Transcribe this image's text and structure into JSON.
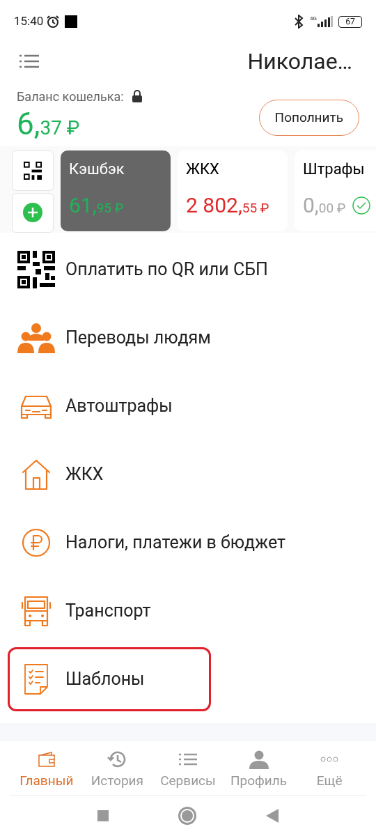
{
  "status_bar": {
    "time": "15:40",
    "network": "4G",
    "battery": "67"
  },
  "header": {
    "user_name": "Николае…"
  },
  "wallet": {
    "label": "Баланс кошелька:",
    "amount_whole": "6,",
    "amount_cents": "37 ₽",
    "top_up_button": "Пополнить"
  },
  "cards": [
    {
      "title": "Кэшбэк",
      "amount_whole": "61,",
      "amount_cents": "95 ₽",
      "selected": true,
      "color": "#1fb35a",
      "paid": false
    },
    {
      "title": "ЖКХ",
      "amount_whole": "2 802,",
      "amount_cents": "55 ₽",
      "selected": false,
      "color": "#e02a2a",
      "paid": false
    },
    {
      "title": "Штрафы",
      "amount_whole": "0,",
      "amount_cents": "00 ₽",
      "selected": false,
      "color": "#a8a8a8",
      "paid": true
    }
  ],
  "menu": [
    {
      "kind": "qr",
      "label": "Оплатить по QR или СБП",
      "highlighted": false
    },
    {
      "kind": "people",
      "label": "Переводы людям",
      "highlighted": false
    },
    {
      "kind": "car",
      "label": "Автоштрафы",
      "highlighted": false
    },
    {
      "kind": "house",
      "label": "ЖКХ",
      "highlighted": false
    },
    {
      "kind": "ruble",
      "label": "Налоги, платежи в бюджет",
      "highlighted": false
    },
    {
      "kind": "bus",
      "label": "Транспорт",
      "highlighted": false
    },
    {
      "kind": "list",
      "label": "Шаблоны",
      "highlighted": true
    }
  ],
  "bottom_nav": [
    {
      "kind": "wallet",
      "label": "Главный",
      "selected": true
    },
    {
      "kind": "history",
      "label": "История",
      "selected": false
    },
    {
      "kind": "services",
      "label": "Сервисы",
      "selected": false
    },
    {
      "kind": "profile",
      "label": "Профиль",
      "selected": false
    },
    {
      "kind": "more",
      "label": "Ещё",
      "selected": false
    }
  ]
}
